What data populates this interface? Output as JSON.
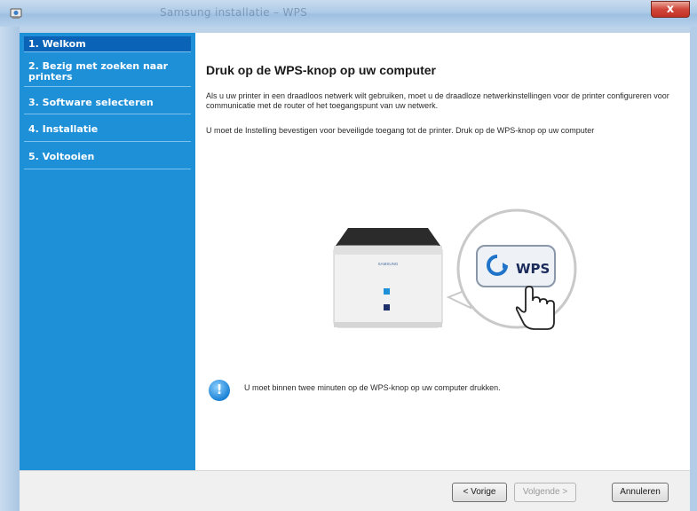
{
  "window": {
    "title": "Samsung installatie – WPS",
    "close_label": "x"
  },
  "sidebar": {
    "items": [
      {
        "label": "1. Welkom",
        "active": true
      },
      {
        "label": "2. Bezig met zoeken naar printers",
        "active": false
      },
      {
        "label": "3. Software selecteren",
        "active": false
      },
      {
        "label": "4. Installatie",
        "active": false
      },
      {
        "label": "5. Voltooien",
        "active": false
      }
    ]
  },
  "main": {
    "heading": "Druk op de WPS-knop op uw computer",
    "paragraph1": "Als u uw printer in een draadloos netwerk wilt gebruiken, moet u de draadloze netwerkinstellingen voor de printer configureren voor communicatie met de router of het toegangspunt van uw netwerk.",
    "paragraph2": "U moet de Instelling bevestigen voor beveiligde toegang tot de printer. Druk op de WPS-knop op uw computer",
    "illustration": {
      "printer_brand": "SAMSUNG",
      "wps_button_label": "WPS"
    },
    "info_icon_glyph": "!",
    "info_text": "U moet binnen twee minuten op de WPS-knop op uw computer drukken."
  },
  "footer": {
    "back_label": "< Vorige",
    "next_label": "Volgende >",
    "cancel_label": "Annuleren"
  },
  "colors": {
    "sidebar_bg": "#1e90d8",
    "sidebar_active": "#0a63b6",
    "close_button": "#c23224"
  }
}
